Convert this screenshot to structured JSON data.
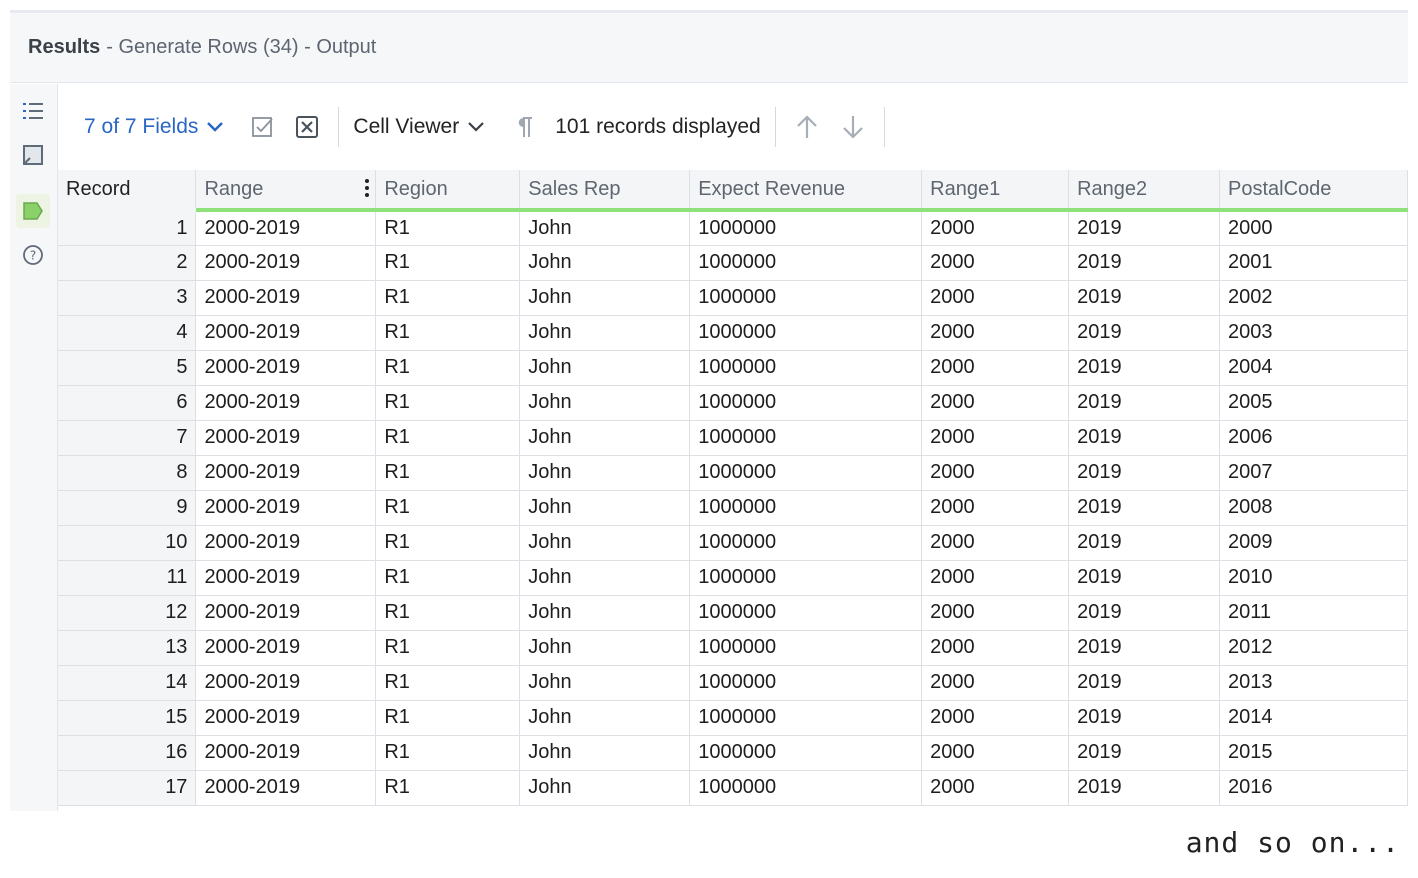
{
  "window": {
    "title_bold": "Results",
    "title_rest": "- Generate Rows (34) - Output"
  },
  "rail": {
    "icons": [
      "list-icon",
      "profile-icon",
      "table-tag-icon",
      "help-icon"
    ]
  },
  "toolbar": {
    "fields_label": "7 of 7 Fields",
    "viewer_label": "Cell Viewer",
    "records_label": "101 records displayed"
  },
  "grid": {
    "columns": [
      "Record",
      "Range",
      "Region",
      "Sales Rep",
      "Expect Revenue",
      "Range1",
      "Range2",
      "PostalCode"
    ],
    "rows": [
      [
        "1",
        "2000-2019",
        "R1",
        "John",
        "1000000",
        "2000",
        "2019",
        "2000"
      ],
      [
        "2",
        "2000-2019",
        "R1",
        "John",
        "1000000",
        "2000",
        "2019",
        "2001"
      ],
      [
        "3",
        "2000-2019",
        "R1",
        "John",
        "1000000",
        "2000",
        "2019",
        "2002"
      ],
      [
        "4",
        "2000-2019",
        "R1",
        "John",
        "1000000",
        "2000",
        "2019",
        "2003"
      ],
      [
        "5",
        "2000-2019",
        "R1",
        "John",
        "1000000",
        "2000",
        "2019",
        "2004"
      ],
      [
        "6",
        "2000-2019",
        "R1",
        "John",
        "1000000",
        "2000",
        "2019",
        "2005"
      ],
      [
        "7",
        "2000-2019",
        "R1",
        "John",
        "1000000",
        "2000",
        "2019",
        "2006"
      ],
      [
        "8",
        "2000-2019",
        "R1",
        "John",
        "1000000",
        "2000",
        "2019",
        "2007"
      ],
      [
        "9",
        "2000-2019",
        "R1",
        "John",
        "1000000",
        "2000",
        "2019",
        "2008"
      ],
      [
        "10",
        "2000-2019",
        "R1",
        "John",
        "1000000",
        "2000",
        "2019",
        "2009"
      ],
      [
        "11",
        "2000-2019",
        "R1",
        "John",
        "1000000",
        "2000",
        "2019",
        "2010"
      ],
      [
        "12",
        "2000-2019",
        "R1",
        "John",
        "1000000",
        "2000",
        "2019",
        "2011"
      ],
      [
        "13",
        "2000-2019",
        "R1",
        "John",
        "1000000",
        "2000",
        "2019",
        "2012"
      ],
      [
        "14",
        "2000-2019",
        "R1",
        "John",
        "1000000",
        "2000",
        "2019",
        "2013"
      ],
      [
        "15",
        "2000-2019",
        "R1",
        "John",
        "1000000",
        "2000",
        "2019",
        "2014"
      ],
      [
        "16",
        "2000-2019",
        "R1",
        "John",
        "1000000",
        "2000",
        "2019",
        "2015"
      ],
      [
        "17",
        "2000-2019",
        "R1",
        "John",
        "1000000",
        "2000",
        "2019",
        "2016"
      ]
    ]
  },
  "colors": {
    "accent_link": "#2a66c4",
    "header_underline": "#8de07a",
    "active_tag": "#8bd16a"
  },
  "footer_note": "and so on..."
}
